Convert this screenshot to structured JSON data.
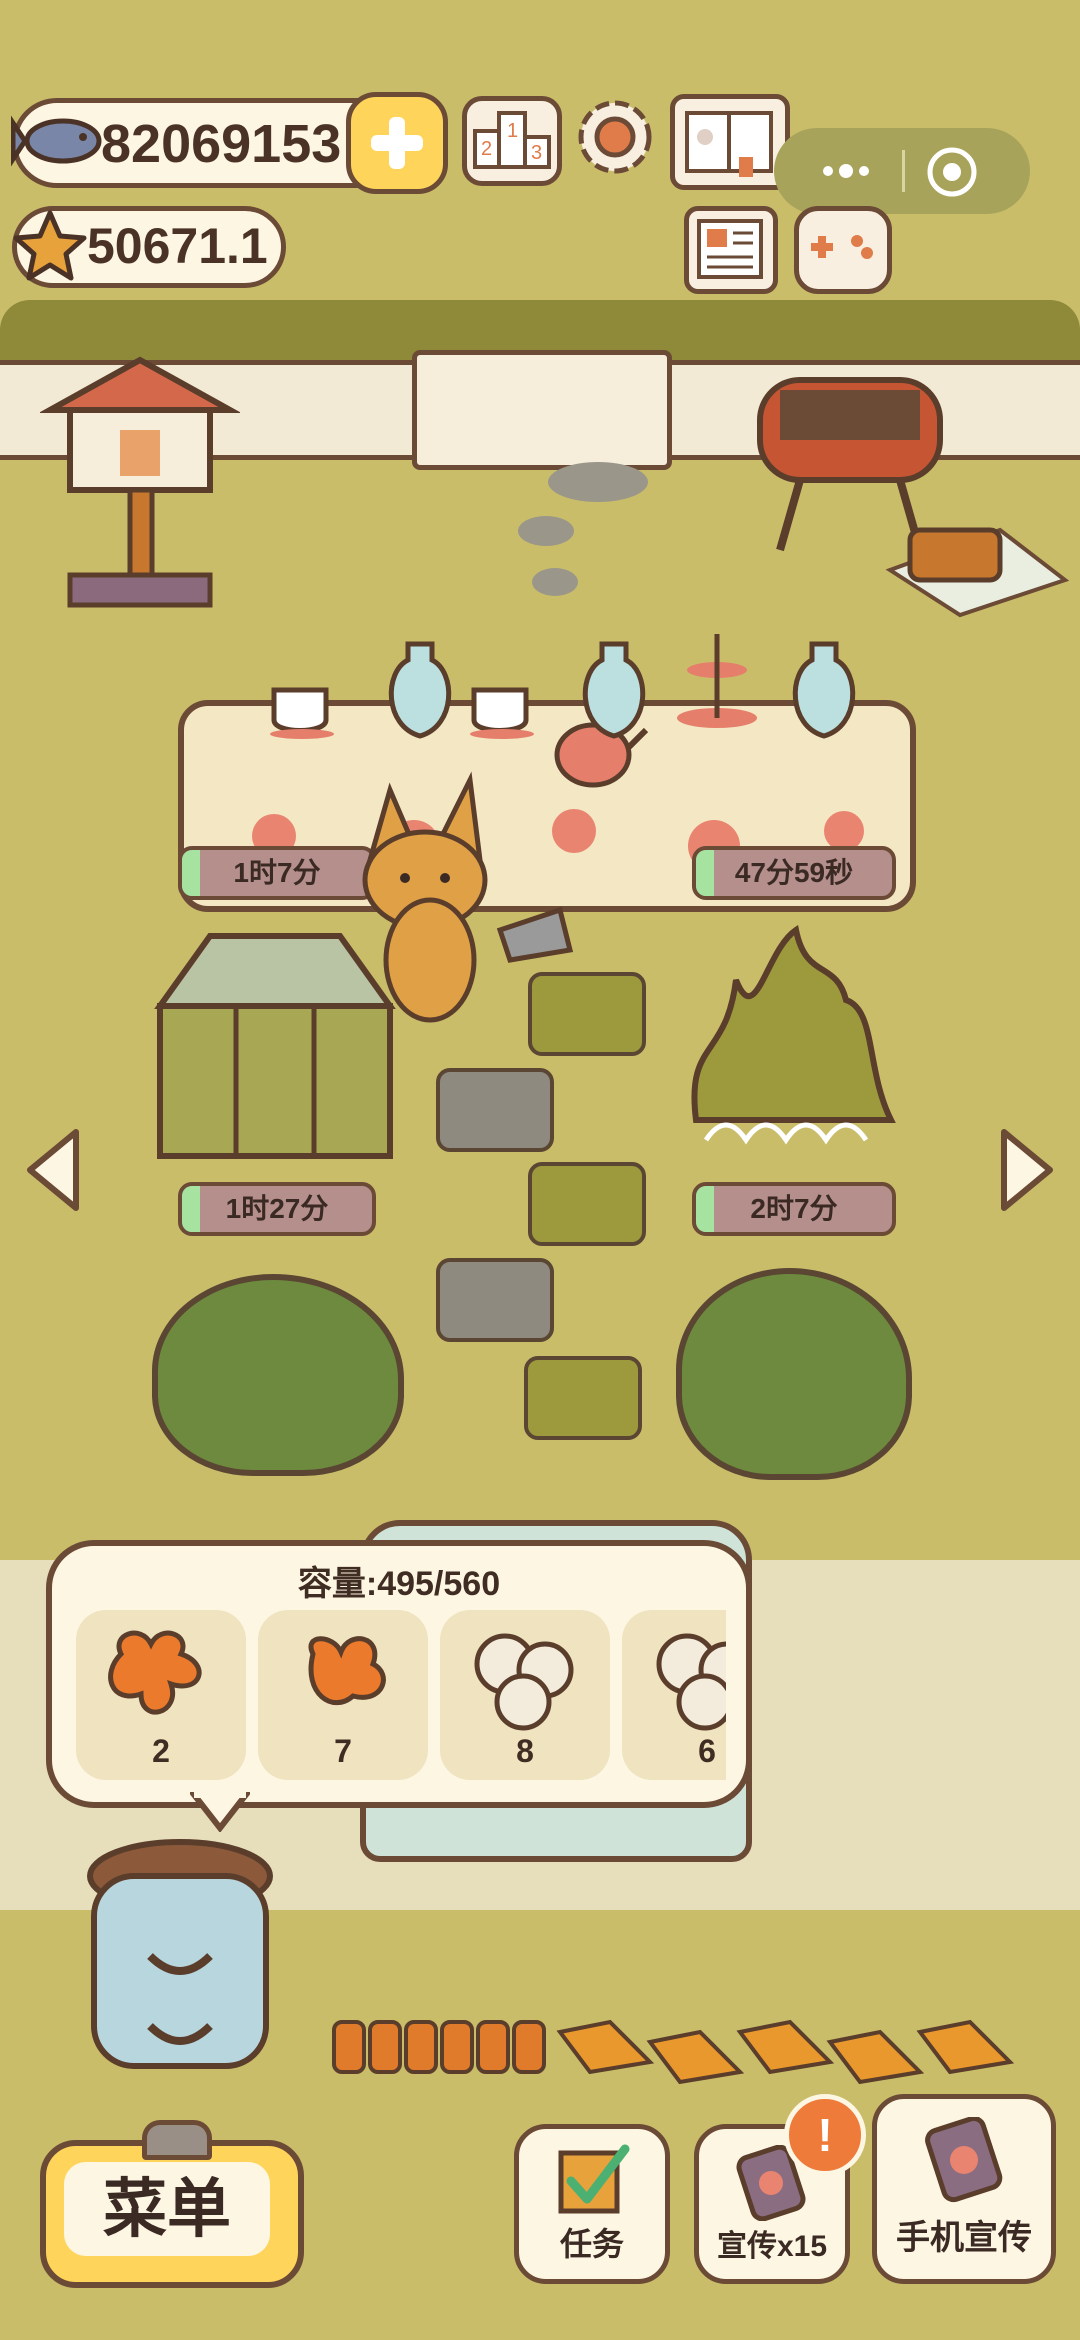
{
  "currency": {
    "fish_amount": "82069153",
    "star_amount": "50671.1"
  },
  "timers": {
    "top_left": "1时7分",
    "top_right": "47分59秒",
    "mid_left": "1时27分",
    "mid_right": "2时7分"
  },
  "storage": {
    "capacity_label": "容量:495/560",
    "items": [
      {
        "icon": "orange-leaves-icon",
        "count": "2"
      },
      {
        "icon": "orange-leaf-icon",
        "count": "7"
      },
      {
        "icon": "white-cotton-icon",
        "count": "8"
      },
      {
        "icon": "white-cotton-icon",
        "count": "6"
      }
    ]
  },
  "bottom_bar": {
    "menu_label": "菜单",
    "tasks_label": "任务",
    "promote_label": "宣传x15",
    "phone_promote_label": "手机宣传",
    "alert_badge": "!"
  },
  "colors": {
    "background": "#c9bd6a",
    "panel": "#fdf6e3",
    "outline": "#6b4a36",
    "menu_yellow": "#ffd45a",
    "timer_fill": "#a6e3a1",
    "alert_orange": "#ef7b3a"
  }
}
